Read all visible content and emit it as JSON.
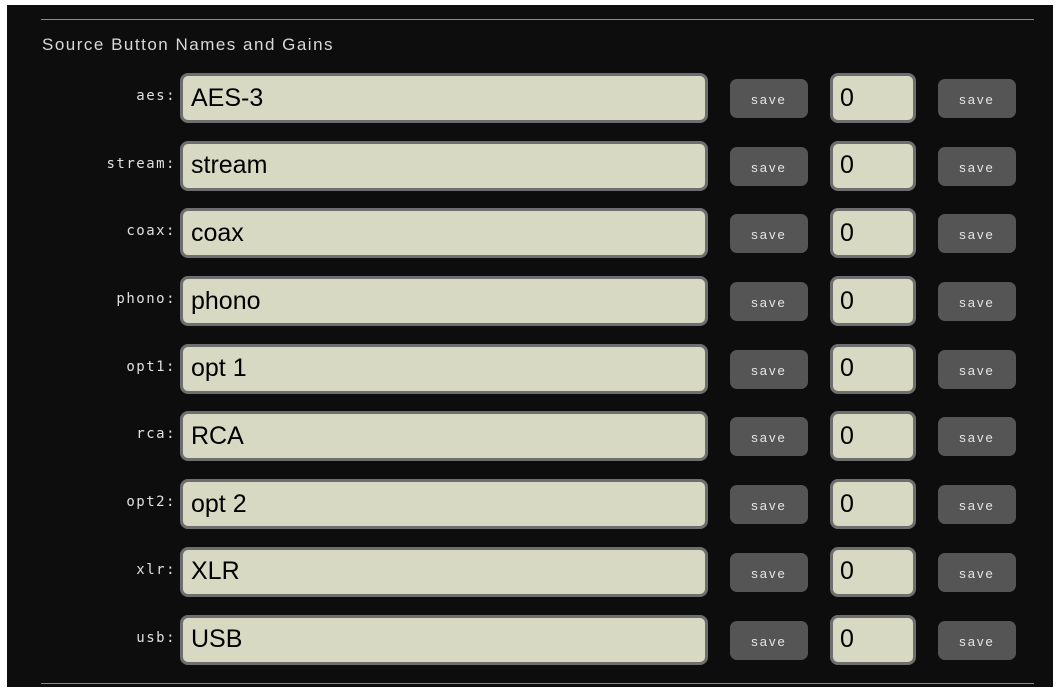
{
  "section": {
    "title": "Source Button Names and Gains"
  },
  "save_label": "save",
  "sources": [
    {
      "key": "aes:",
      "name": "AES-3",
      "gain": "0"
    },
    {
      "key": "stream:",
      "name": "stream",
      "gain": "0"
    },
    {
      "key": "coax:",
      "name": "coax",
      "gain": "0"
    },
    {
      "key": "phono:",
      "name": "phono",
      "gain": "0"
    },
    {
      "key": "opt1:",
      "name": "opt 1",
      "gain": "0"
    },
    {
      "key": "rca:",
      "name": "RCA",
      "gain": "0"
    },
    {
      "key": "opt2:",
      "name": "opt 2",
      "gain": "0"
    },
    {
      "key": "xlr:",
      "name": "XLR",
      "gain": "0"
    },
    {
      "key": "usb:",
      "name": "USB",
      "gain": "0"
    }
  ],
  "colors": {
    "background": "#0d0d0d",
    "field": "#d8d9c3",
    "field_border": "#6e6e6e",
    "button": "#555555"
  }
}
